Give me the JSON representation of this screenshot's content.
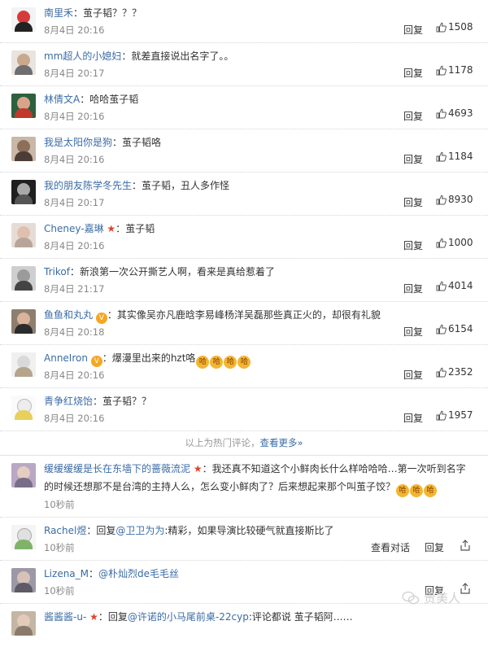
{
  "comments_hot": [
    {
      "user": "南里禾",
      "sep": "：",
      "text": "茧子韬？？？",
      "time": "8月4日 20:16",
      "reply": "回复",
      "likes": "1508",
      "avatar": "#d63a3a"
    },
    {
      "user": "mm超人的小媳妇",
      "sep": "：",
      "text": "就差直接说出名字了。。",
      "time": "8月4日 20:17",
      "reply": "回复",
      "likes": "1178",
      "avatar": "#6e6e6e"
    },
    {
      "user": "林倩文A",
      "sep": "：",
      "text": "哈哈茧子韬",
      "time": "8月4日 20:16",
      "reply": "回复",
      "likes": "4693",
      "avatar": "#c0392b"
    },
    {
      "user": "我是太阳你是狗",
      "sep": "：",
      "text": "茧子韬咯",
      "time": "8月4日 20:16",
      "reply": "回复",
      "likes": "1184",
      "avatar": "#8c6f5a"
    },
    {
      "user": "我的朋友陈学冬先生",
      "sep": "：",
      "text": "茧子韬，丑人多作怪",
      "time": "8月4日 20:17",
      "reply": "回复",
      "likes": "8930",
      "avatar": "#3d3d3d"
    },
    {
      "user": "Cheney-嘉琳",
      "sep": "：",
      "text": "茧子韬",
      "time": "8月4日 20:16",
      "reply": "回复",
      "likes": "1000",
      "avatar": "#b8a59a",
      "star": "★"
    },
    {
      "user": "Trikof",
      "sep": "：",
      "text": "新浪第一次公开撕艺人啊，看来是真给惹着了",
      "time": "8月4日 21:17",
      "reply": "回复",
      "likes": "4014",
      "avatar": "#9b9b9b"
    },
    {
      "user": "鱼鱼和丸丸",
      "sep": "：",
      "text": "其实像吴亦凡鹿晗李易峰杨洋吴磊那些真正火的，却很有礼貌",
      "time": "8月4日 20:18",
      "reply": "回复",
      "likes": "6154",
      "avatar": "#4a3b33",
      "vip": "V"
    },
    {
      "user": "AnneIron",
      "sep": "：",
      "text": "爆漫里出来的hzt咯",
      "time": "8月4日 20:16",
      "reply": "回复",
      "likes": "2352",
      "avatar": "#d9d9d9",
      "vip": "V",
      "emojis": [
        "哈",
        "哈",
        "哈",
        "哈"
      ]
    },
    {
      "user": "青争红烧饴",
      "sep": "：",
      "text": "茧子韬？？",
      "time": "8月4日 20:16",
      "reply": "回复",
      "likes": "1957",
      "avatar": "#e8e8e8"
    }
  ],
  "divider": {
    "text": "以上为热门评论，",
    "more": "查看更多»"
  },
  "comments_new": [
    {
      "user": "缓缓缓缓是长在东墙下的蔷薇流泥",
      "star": "★",
      "sep": "：",
      "text": "我还真不知道这个小鲜肉长什么样哈哈哈…第一次听到名字",
      "text2": "的时候还想那不是台湾的主持人么，怎么变小鲜肉了？后来想起来那个叫茧子饺？",
      "time": "10秒前",
      "reply": "回复",
      "avatar": "#7a6d8a",
      "emojis": [
        "哈",
        "哈",
        "哈"
      ]
    },
    {
      "user": "Rachel煜",
      "sep": "：",
      "prefix": "回复",
      "at": "@卫卫为为",
      "text": ":精彩，如果导演比较硬气就直接斯比了",
      "time": "10秒前",
      "convo": "查看对话",
      "reply": "回复",
      "avatar": "#e0e0e0"
    },
    {
      "user": "Lizena_M",
      "sep": "：",
      "at": "@朴灿烈de毛毛丝",
      "text": "",
      "time": "10秒前",
      "reply": "回复",
      "avatar": "#5e5a66"
    },
    {
      "user": "酱酱酱-u-",
      "star": "★",
      "sep": "：",
      "prefix": "回复",
      "at": "@许诺的小马尾前桌-22cyp",
      "text": ":评论都说 茧子韬阿……",
      "time": "",
      "reply": "",
      "avatar": "#8a7a6a"
    }
  ],
  "watermark": "贵美人"
}
